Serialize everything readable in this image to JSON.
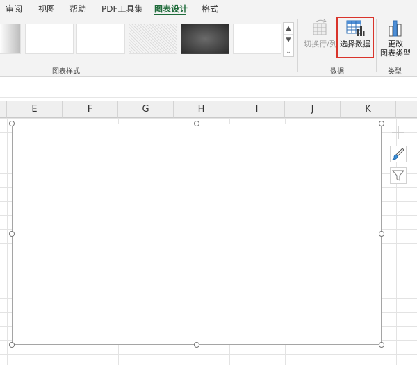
{
  "tabs": [
    {
      "label": "审阅"
    },
    {
      "label": "视图"
    },
    {
      "label": "帮助"
    },
    {
      "label": "PDF工具集"
    },
    {
      "label": "图表设计"
    },
    {
      "label": "格式"
    }
  ],
  "ribbon": {
    "groups": {
      "chart_styles": "图表样式",
      "data": "数据",
      "type": "类型"
    },
    "buttons": {
      "switch_row_col": "切换行/列",
      "select_data": "选择数据",
      "change_chart_type_line1": "更改",
      "change_chart_type_line2": "图表类型"
    },
    "gallery_scroll": {
      "up": "▲",
      "down": "▼",
      "more": "⌄"
    }
  },
  "columns": [
    "E",
    "F",
    "G",
    "H",
    "I",
    "J",
    "K"
  ],
  "side_buttons": [
    "plus-icon",
    "brush-icon",
    "filter-icon"
  ],
  "colors": {
    "accent": "#1e6b3a",
    "highlight": "#d9342b"
  }
}
